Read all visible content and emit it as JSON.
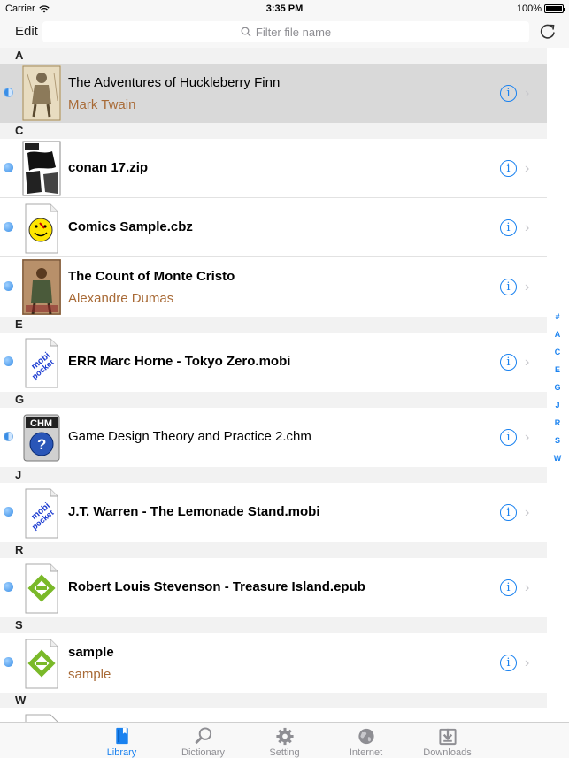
{
  "status": {
    "carrier": "Carrier",
    "time": "3:35 PM",
    "battery": "100%"
  },
  "nav": {
    "edit_label": "Edit",
    "search_placeholder": "Filter file name"
  },
  "sections": [
    {
      "letter": "A",
      "items": [
        {
          "title": "The Adventures of Huckleberry Finn",
          "author": "Mark Twain",
          "bold": false,
          "selected": true,
          "dot": "half",
          "thumb": "photo-huck"
        }
      ]
    },
    {
      "letter": "C",
      "items": [
        {
          "title": "conan 17.zip",
          "author": "",
          "bold": true,
          "dot": "full",
          "thumb": "photo-comic"
        },
        {
          "title": "Comics Sample.cbz",
          "author": "",
          "bold": true,
          "dot": "full",
          "thumb": "smiley-icon"
        },
        {
          "title": "The Count of Monte Cristo",
          "author": "Alexandre Dumas",
          "bold": true,
          "dot": "full",
          "thumb": "photo-dumas"
        }
      ]
    },
    {
      "letter": "E",
      "items": [
        {
          "title": "ERR Marc Horne - Tokyo Zero.mobi",
          "author": "",
          "bold": true,
          "dot": "full",
          "thumb": "mobipocket-icon"
        }
      ]
    },
    {
      "letter": "G",
      "items": [
        {
          "title": "Game Design Theory and Practice 2.chm",
          "author": "",
          "bold": false,
          "dot": "half",
          "thumb": "chm-icon"
        }
      ]
    },
    {
      "letter": "J",
      "items": [
        {
          "title": "J.T. Warren - The Lemonade Stand.mobi",
          "author": "",
          "bold": true,
          "dot": "full",
          "thumb": "mobipocket-icon"
        }
      ]
    },
    {
      "letter": "R",
      "items": [
        {
          "title": "Robert Louis Stevenson - Treasure Island.epub",
          "author": "",
          "bold": true,
          "dot": "full",
          "thumb": "epub-icon"
        }
      ]
    },
    {
      "letter": "S",
      "items": [
        {
          "title": "sample",
          "author": "sample",
          "bold": true,
          "dot": "full",
          "thumb": "epub-icon"
        }
      ]
    },
    {
      "letter": "W",
      "items": []
    }
  ],
  "index": [
    "#",
    "A",
    "C",
    "E",
    "G",
    "J",
    "R",
    "S",
    "W"
  ],
  "tabs": [
    {
      "label": "Library",
      "icon": "book-icon",
      "active": true
    },
    {
      "label": "Dictionary",
      "icon": "magnifier-icon",
      "active": false
    },
    {
      "label": "Setting",
      "icon": "gear-icon",
      "active": false
    },
    {
      "label": "Internet",
      "icon": "globe-icon",
      "active": false
    },
    {
      "label": "Downloads",
      "icon": "download-icon",
      "active": false
    }
  ],
  "colors": {
    "accent": "#1a82f0",
    "author": "#a86a36",
    "selected_row": "#d9d9d9"
  }
}
